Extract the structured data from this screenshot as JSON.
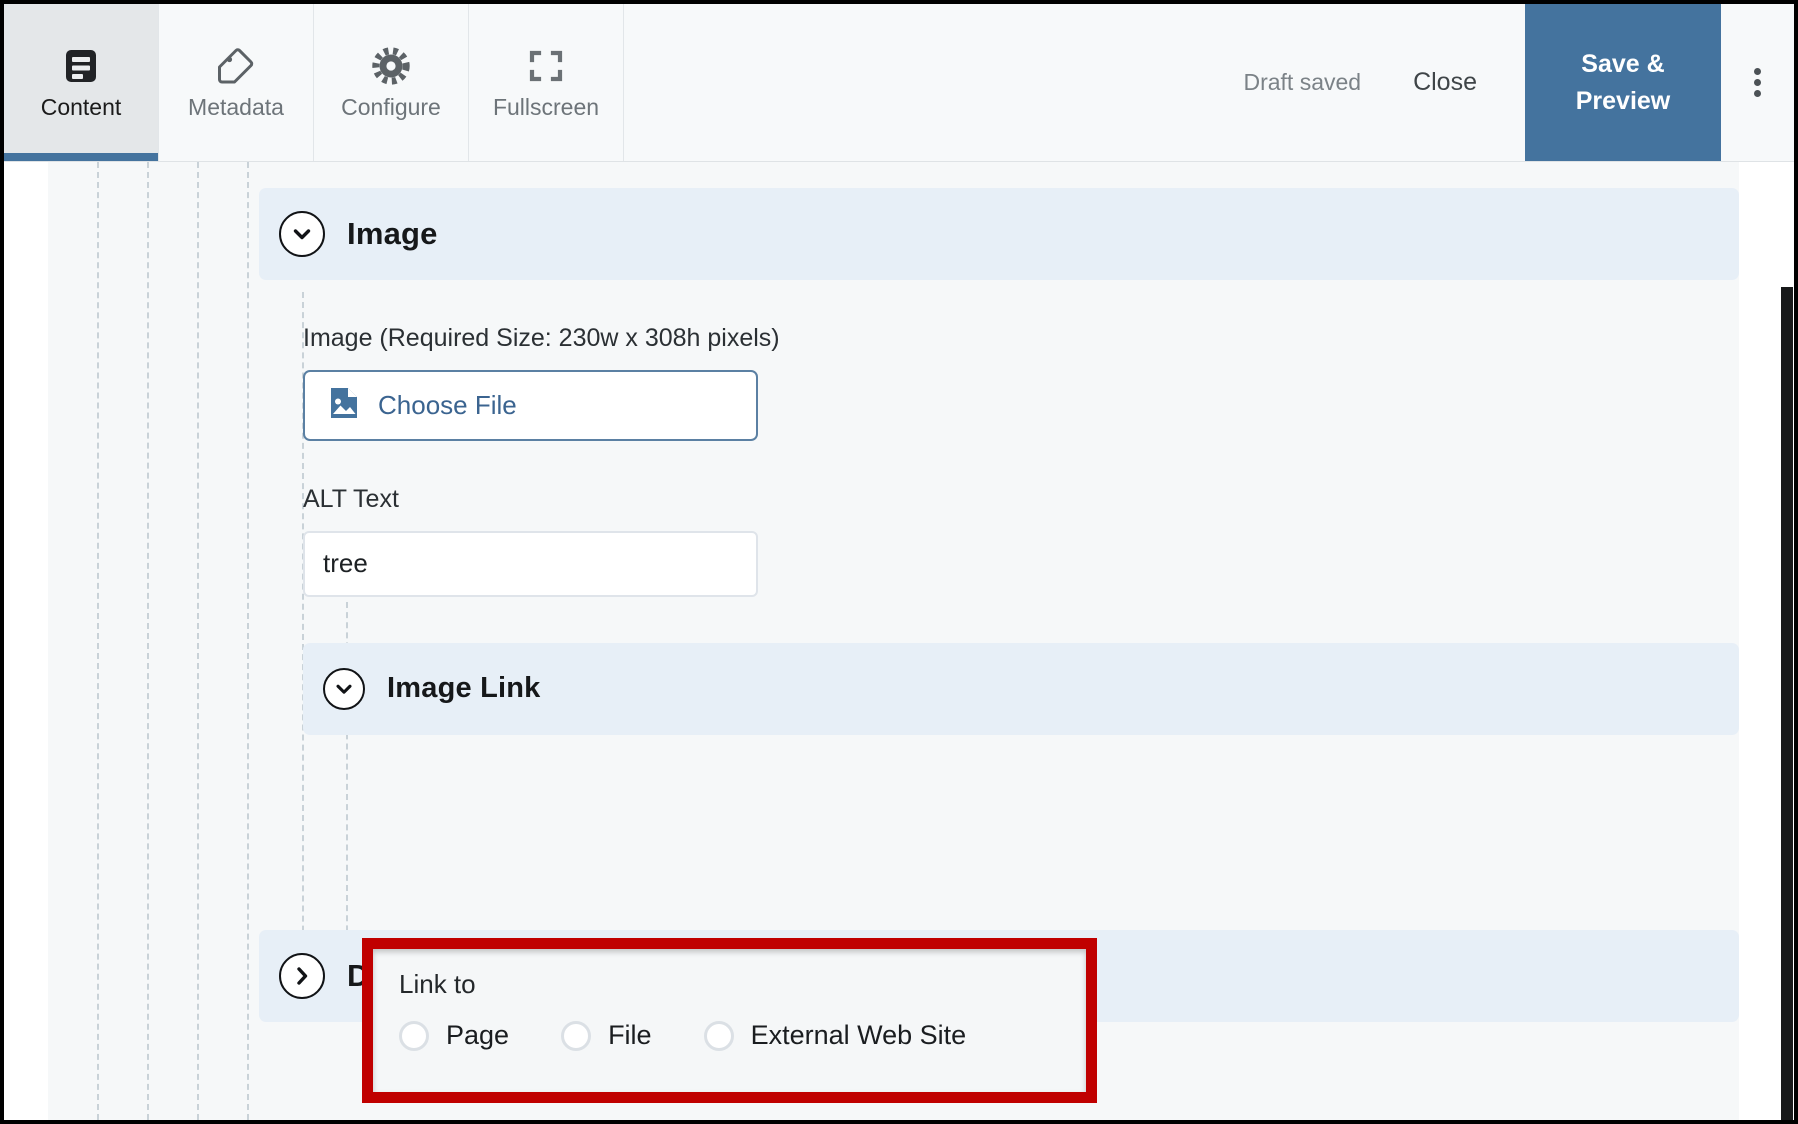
{
  "toolbar": {
    "tabs": [
      {
        "label": "Content",
        "icon": "content-icon",
        "active": true
      },
      {
        "label": "Metadata",
        "icon": "tag-icon",
        "active": false
      },
      {
        "label": "Configure",
        "icon": "gear-icon",
        "active": false
      },
      {
        "label": "Fullscreen",
        "icon": "fullscreen-icon",
        "active": false
      }
    ],
    "draft_status": "Draft saved",
    "close_label": "Close",
    "save_preview_label": "Save & Preview",
    "save_preview_line1": "Save &",
    "save_preview_line2": "Preview",
    "overflow_icon": "kebab-menu-icon"
  },
  "accent_colors": {
    "primary_blue": "#44739e",
    "section_header_bg": "#e7eff7",
    "highlight_red": "#c00000",
    "link_blue": "#3b6490",
    "canvas_bg": "#f6f8f9"
  },
  "form": {
    "image_section": {
      "title": "Image",
      "chevron": "chevron-down-icon",
      "expanded": true,
      "image_field": {
        "label": "Image (Required Size: 230w x 308h pixels)",
        "choose_file_label": "Choose File",
        "icon": "image-file-icon"
      },
      "alt_text_field": {
        "label": "ALT Text",
        "value": "tree",
        "placeholder": ""
      }
    },
    "image_link_section": {
      "title": "Image Link",
      "chevron": "chevron-down-icon",
      "expanded": true,
      "link_to": {
        "label": "Link to",
        "selected": "",
        "options": [
          {
            "label": "Page",
            "selected": false
          },
          {
            "label": "File",
            "selected": false
          },
          {
            "label": "External Web Site",
            "selected": false
          }
        ]
      }
    },
    "description_section": {
      "title": "Description",
      "chevron": "chevron-right-icon",
      "expanded": false
    }
  }
}
